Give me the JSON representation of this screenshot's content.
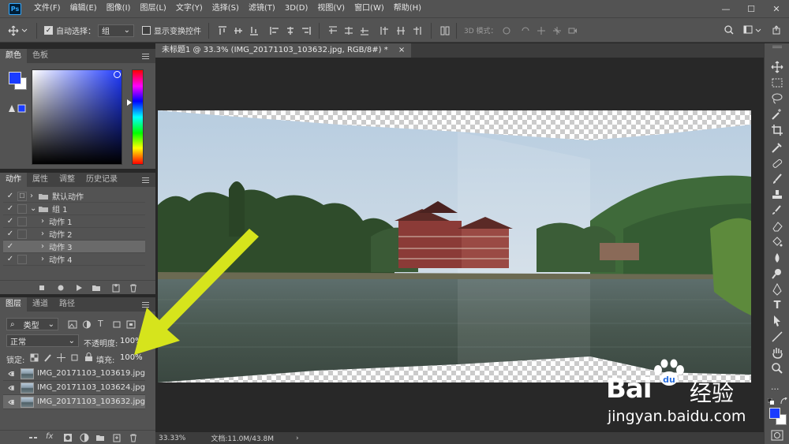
{
  "menu": {
    "logo": "Ps",
    "items": [
      "文件(F)",
      "编辑(E)",
      "图像(I)",
      "图层(L)",
      "文字(Y)",
      "选择(S)",
      "滤镜(T)",
      "3D(D)",
      "视图(V)",
      "窗口(W)",
      "帮助(H)"
    ],
    "minimize": "—",
    "maximize": "☐",
    "close": "✕"
  },
  "options": {
    "auto_select_label": "自动选择：",
    "auto_select_value": "组",
    "show_transform_label": "显示变换控件",
    "mode_3d_label": "3D 模式："
  },
  "color_panel": {
    "tabs": [
      "颜色",
      "色板"
    ],
    "foreground": "#1a3cff",
    "background": "#ffffff"
  },
  "actions_panel": {
    "tabs": [
      "动作",
      "属性",
      "调整",
      "历史记录"
    ],
    "rows": [
      {
        "check": "✓",
        "label": "默认动作",
        "level": 0,
        "folder": true,
        "arrow": "›"
      },
      {
        "check": "✓",
        "label": "组 1",
        "level": 0,
        "folder": true,
        "arrow": "⌄"
      },
      {
        "check": "✓",
        "label": "动作 1",
        "level": 1,
        "folder": false,
        "arrow": "›"
      },
      {
        "check": "✓",
        "label": "动作 2",
        "level": 1,
        "folder": false,
        "arrow": "›"
      },
      {
        "check": "✓",
        "label": "动作 3",
        "level": 1,
        "folder": false,
        "arrow": "›",
        "selected": true
      },
      {
        "check": "✓",
        "label": "动作 4",
        "level": 1,
        "folder": false,
        "arrow": "›"
      }
    ]
  },
  "layers_panel": {
    "tabs": [
      "图层",
      "通道",
      "路径"
    ],
    "filter_label": "类型",
    "blend_mode": "正常",
    "opacity_label": "不透明度:",
    "opacity_value": "100%",
    "lock_label": "锁定:",
    "fill_label": "填充:",
    "fill_value": "100%",
    "layers": [
      {
        "name": "IMG_20171103_103619.jpg",
        "selected": false
      },
      {
        "name": "IMG_20171103_103624.jpg",
        "selected": false
      },
      {
        "name": "IMG_20171103_103632.jpg",
        "selected": true
      }
    ],
    "fx_label": "fx"
  },
  "document": {
    "tab_title": "未标题1 @ 33.3% (IMG_20171103_103632.jpg, RGB/8#) *",
    "tab_close": "×"
  },
  "status": {
    "zoom": "33.33%",
    "doc_info": "文档:11.0M/43.8M",
    "arrow": "›"
  },
  "watermark": {
    "brand": "Bai",
    "brand_cn": "经验",
    "url": "jingyan.baidu.com"
  },
  "colors": {
    "arrow": "#d6e41c"
  }
}
